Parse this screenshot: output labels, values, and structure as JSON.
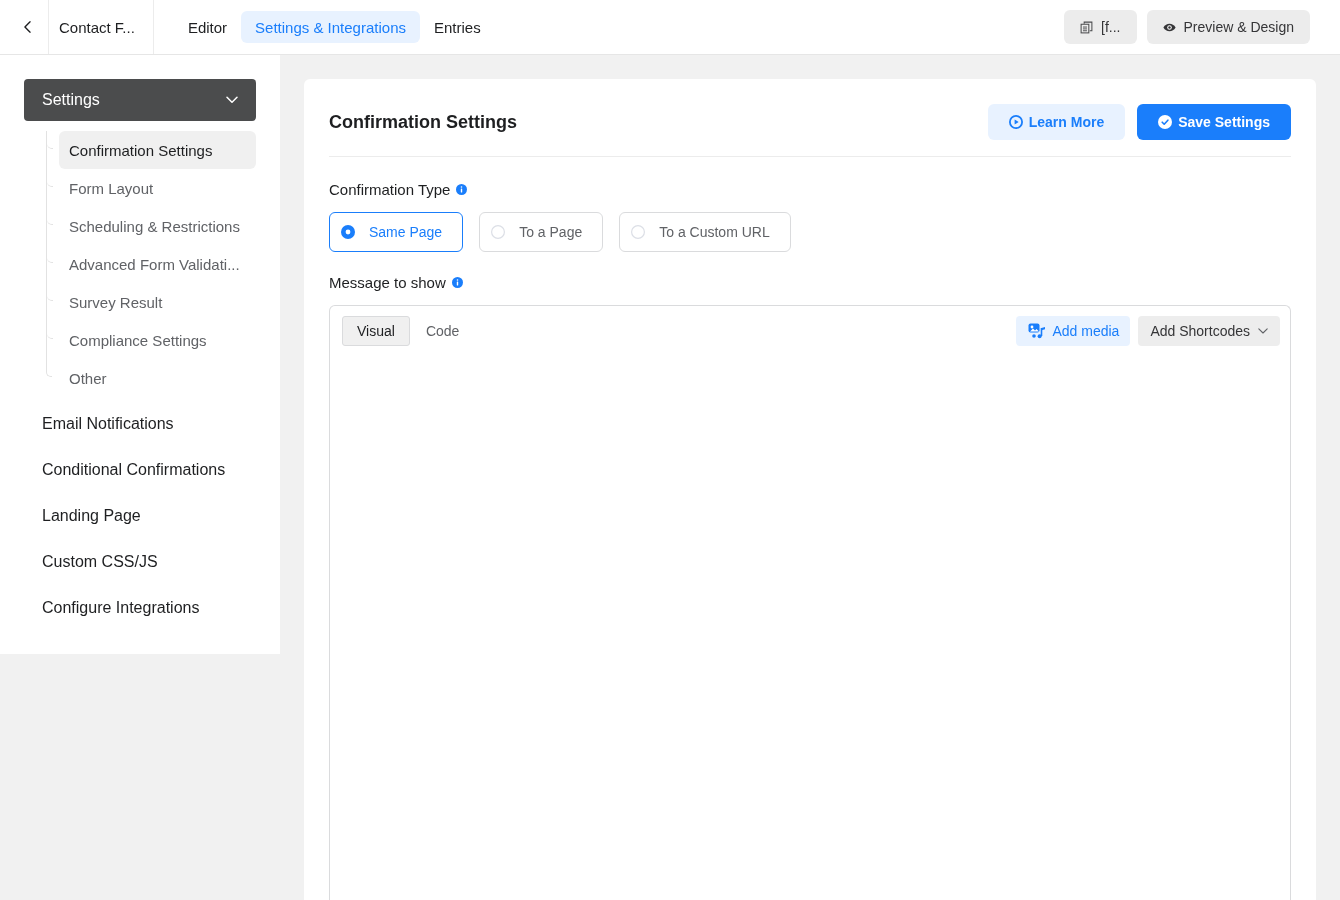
{
  "top_bar": {
    "form_title": "Contact F...",
    "tabs": [
      {
        "label": "Editor",
        "selected": false
      },
      {
        "label": "Settings & Integrations",
        "selected": true
      },
      {
        "label": "Entries",
        "selected": false
      }
    ],
    "shortcode_button": "[f...",
    "preview_button": "Preview & Design"
  },
  "sidebar": {
    "group": {
      "label": "Settings",
      "expanded": true,
      "items": [
        {
          "label": "Confirmation Settings",
          "selected": true
        },
        {
          "label": "Form Layout",
          "selected": false
        },
        {
          "label": "Scheduling & Restrictions",
          "selected": false
        },
        {
          "label": "Advanced Form Validati...",
          "selected": false
        },
        {
          "label": "Survey Result",
          "selected": false
        },
        {
          "label": "Compliance Settings",
          "selected": false
        },
        {
          "label": "Other",
          "selected": false
        }
      ]
    },
    "links": [
      {
        "label": "Email Notifications",
        "selected": false
      },
      {
        "label": "Conditional Confirmations",
        "selected": false
      },
      {
        "label": "Landing Page",
        "selected": false
      },
      {
        "label": "Custom CSS/JS",
        "selected": false
      },
      {
        "label": "Configure Integrations",
        "selected": false
      }
    ]
  },
  "panel": {
    "title": "Confirmation Settings",
    "buttons": [
      {
        "label": "Learn More",
        "kind": "secondary"
      },
      {
        "label": "Save Settings",
        "kind": "primary"
      }
    ],
    "confirmation_type": {
      "label": "Confirmation Type",
      "options": [
        {
          "label": "Same Page",
          "selected": true
        },
        {
          "label": "To a Page",
          "selected": false
        },
        {
          "label": "To a Custom URL",
          "selected": false
        }
      ]
    },
    "message": {
      "label": "Message to show",
      "editor": {
        "tabs": [
          {
            "label": "Visual",
            "selected": true
          },
          {
            "label": "Code",
            "selected": false
          }
        ],
        "add_media": "Add media",
        "shortcodes": "Add Shortcodes"
      }
    }
  }
}
